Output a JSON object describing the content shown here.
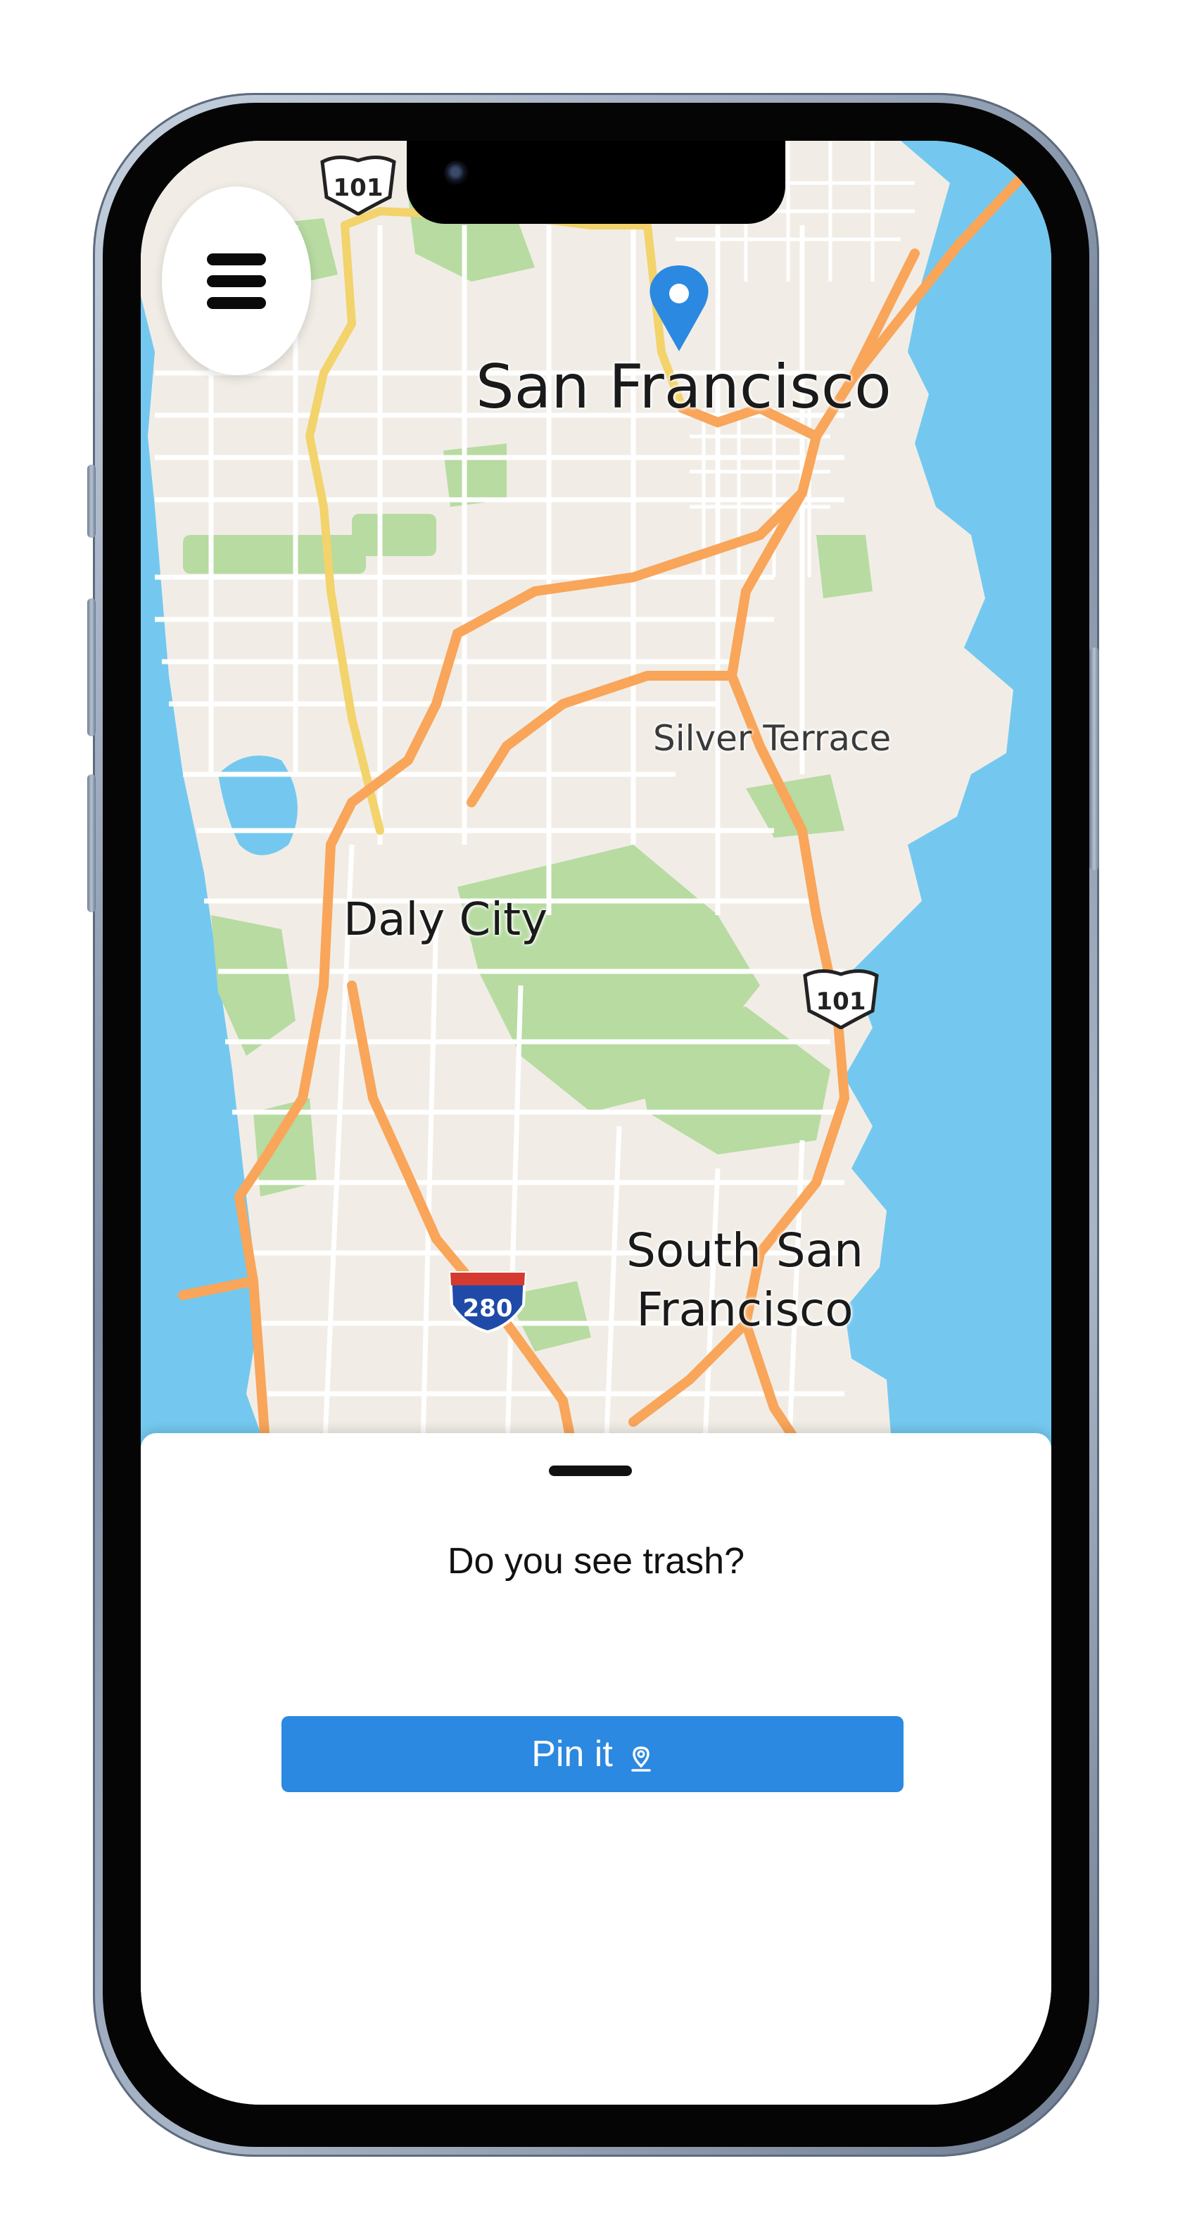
{
  "map": {
    "labels": {
      "san_francisco": "San Francisco",
      "silver_terrace": "Silver Terrace",
      "daly_city": "Daly City",
      "south_sf_line1": "South San",
      "south_sf_line2": "Francisco"
    },
    "shields": {
      "us101_top": "101",
      "us101_right": "101",
      "i280": "280"
    },
    "colors": {
      "water": "#74c8ef",
      "land": "#f1ede6",
      "park": "#b7dba1",
      "highway": "#f9a55a",
      "major_road": "#f3d36b"
    }
  },
  "menu": {
    "icon": "hamburger-menu-icon"
  },
  "marker": {
    "icon": "location-pin-icon",
    "color": "#2b89e1"
  },
  "sheet": {
    "question": "Do you see trash?",
    "button_label": "Pin it",
    "button_icon": "map-pin-outline-icon",
    "button_color": "#2b89e1"
  }
}
